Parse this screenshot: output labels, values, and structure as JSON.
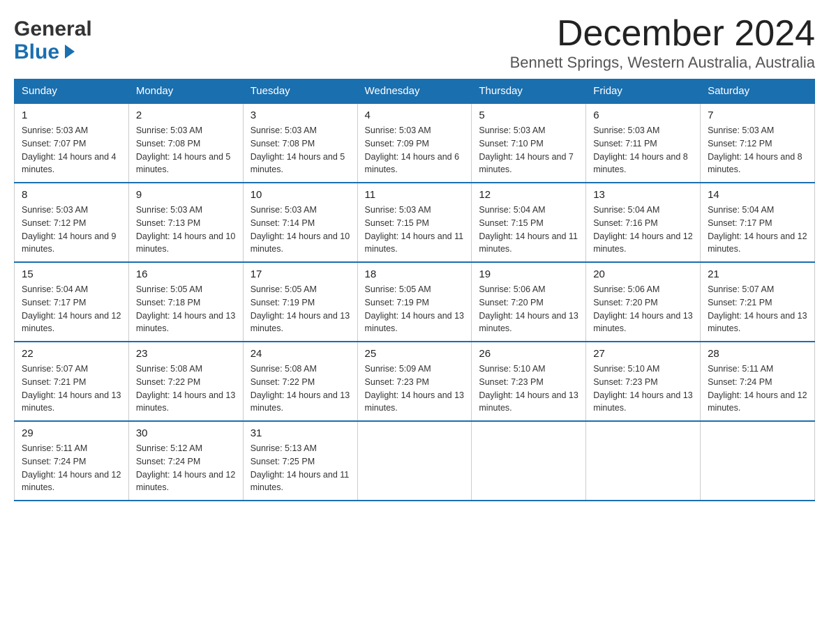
{
  "header": {
    "logo_general": "General",
    "logo_blue": "Blue",
    "month_title": "December 2024",
    "location": "Bennett Springs, Western Australia, Australia"
  },
  "days_of_week": [
    "Sunday",
    "Monday",
    "Tuesday",
    "Wednesday",
    "Thursday",
    "Friday",
    "Saturday"
  ],
  "weeks": [
    [
      {
        "day": "1",
        "sunrise": "Sunrise: 5:03 AM",
        "sunset": "Sunset: 7:07 PM",
        "daylight": "Daylight: 14 hours and 4 minutes."
      },
      {
        "day": "2",
        "sunrise": "Sunrise: 5:03 AM",
        "sunset": "Sunset: 7:08 PM",
        "daylight": "Daylight: 14 hours and 5 minutes."
      },
      {
        "day": "3",
        "sunrise": "Sunrise: 5:03 AM",
        "sunset": "Sunset: 7:08 PM",
        "daylight": "Daylight: 14 hours and 5 minutes."
      },
      {
        "day": "4",
        "sunrise": "Sunrise: 5:03 AM",
        "sunset": "Sunset: 7:09 PM",
        "daylight": "Daylight: 14 hours and 6 minutes."
      },
      {
        "day": "5",
        "sunrise": "Sunrise: 5:03 AM",
        "sunset": "Sunset: 7:10 PM",
        "daylight": "Daylight: 14 hours and 7 minutes."
      },
      {
        "day": "6",
        "sunrise": "Sunrise: 5:03 AM",
        "sunset": "Sunset: 7:11 PM",
        "daylight": "Daylight: 14 hours and 8 minutes."
      },
      {
        "day": "7",
        "sunrise": "Sunrise: 5:03 AM",
        "sunset": "Sunset: 7:12 PM",
        "daylight": "Daylight: 14 hours and 8 minutes."
      }
    ],
    [
      {
        "day": "8",
        "sunrise": "Sunrise: 5:03 AM",
        "sunset": "Sunset: 7:12 PM",
        "daylight": "Daylight: 14 hours and 9 minutes."
      },
      {
        "day": "9",
        "sunrise": "Sunrise: 5:03 AM",
        "sunset": "Sunset: 7:13 PM",
        "daylight": "Daylight: 14 hours and 10 minutes."
      },
      {
        "day": "10",
        "sunrise": "Sunrise: 5:03 AM",
        "sunset": "Sunset: 7:14 PM",
        "daylight": "Daylight: 14 hours and 10 minutes."
      },
      {
        "day": "11",
        "sunrise": "Sunrise: 5:03 AM",
        "sunset": "Sunset: 7:15 PM",
        "daylight": "Daylight: 14 hours and 11 minutes."
      },
      {
        "day": "12",
        "sunrise": "Sunrise: 5:04 AM",
        "sunset": "Sunset: 7:15 PM",
        "daylight": "Daylight: 14 hours and 11 minutes."
      },
      {
        "day": "13",
        "sunrise": "Sunrise: 5:04 AM",
        "sunset": "Sunset: 7:16 PM",
        "daylight": "Daylight: 14 hours and 12 minutes."
      },
      {
        "day": "14",
        "sunrise": "Sunrise: 5:04 AM",
        "sunset": "Sunset: 7:17 PM",
        "daylight": "Daylight: 14 hours and 12 minutes."
      }
    ],
    [
      {
        "day": "15",
        "sunrise": "Sunrise: 5:04 AM",
        "sunset": "Sunset: 7:17 PM",
        "daylight": "Daylight: 14 hours and 12 minutes."
      },
      {
        "day": "16",
        "sunrise": "Sunrise: 5:05 AM",
        "sunset": "Sunset: 7:18 PM",
        "daylight": "Daylight: 14 hours and 13 minutes."
      },
      {
        "day": "17",
        "sunrise": "Sunrise: 5:05 AM",
        "sunset": "Sunset: 7:19 PM",
        "daylight": "Daylight: 14 hours and 13 minutes."
      },
      {
        "day": "18",
        "sunrise": "Sunrise: 5:05 AM",
        "sunset": "Sunset: 7:19 PM",
        "daylight": "Daylight: 14 hours and 13 minutes."
      },
      {
        "day": "19",
        "sunrise": "Sunrise: 5:06 AM",
        "sunset": "Sunset: 7:20 PM",
        "daylight": "Daylight: 14 hours and 13 minutes."
      },
      {
        "day": "20",
        "sunrise": "Sunrise: 5:06 AM",
        "sunset": "Sunset: 7:20 PM",
        "daylight": "Daylight: 14 hours and 13 minutes."
      },
      {
        "day": "21",
        "sunrise": "Sunrise: 5:07 AM",
        "sunset": "Sunset: 7:21 PM",
        "daylight": "Daylight: 14 hours and 13 minutes."
      }
    ],
    [
      {
        "day": "22",
        "sunrise": "Sunrise: 5:07 AM",
        "sunset": "Sunset: 7:21 PM",
        "daylight": "Daylight: 14 hours and 13 minutes."
      },
      {
        "day": "23",
        "sunrise": "Sunrise: 5:08 AM",
        "sunset": "Sunset: 7:22 PM",
        "daylight": "Daylight: 14 hours and 13 minutes."
      },
      {
        "day": "24",
        "sunrise": "Sunrise: 5:08 AM",
        "sunset": "Sunset: 7:22 PM",
        "daylight": "Daylight: 14 hours and 13 minutes."
      },
      {
        "day": "25",
        "sunrise": "Sunrise: 5:09 AM",
        "sunset": "Sunset: 7:23 PM",
        "daylight": "Daylight: 14 hours and 13 minutes."
      },
      {
        "day": "26",
        "sunrise": "Sunrise: 5:10 AM",
        "sunset": "Sunset: 7:23 PM",
        "daylight": "Daylight: 14 hours and 13 minutes."
      },
      {
        "day": "27",
        "sunrise": "Sunrise: 5:10 AM",
        "sunset": "Sunset: 7:23 PM",
        "daylight": "Daylight: 14 hours and 13 minutes."
      },
      {
        "day": "28",
        "sunrise": "Sunrise: 5:11 AM",
        "sunset": "Sunset: 7:24 PM",
        "daylight": "Daylight: 14 hours and 12 minutes."
      }
    ],
    [
      {
        "day": "29",
        "sunrise": "Sunrise: 5:11 AM",
        "sunset": "Sunset: 7:24 PM",
        "daylight": "Daylight: 14 hours and 12 minutes."
      },
      {
        "day": "30",
        "sunrise": "Sunrise: 5:12 AM",
        "sunset": "Sunset: 7:24 PM",
        "daylight": "Daylight: 14 hours and 12 minutes."
      },
      {
        "day": "31",
        "sunrise": "Sunrise: 5:13 AM",
        "sunset": "Sunset: 7:25 PM",
        "daylight": "Daylight: 14 hours and 11 minutes."
      },
      {
        "day": "",
        "sunrise": "",
        "sunset": "",
        "daylight": ""
      },
      {
        "day": "",
        "sunrise": "",
        "sunset": "",
        "daylight": ""
      },
      {
        "day": "",
        "sunrise": "",
        "sunset": "",
        "daylight": ""
      },
      {
        "day": "",
        "sunrise": "",
        "sunset": "",
        "daylight": ""
      }
    ]
  ]
}
